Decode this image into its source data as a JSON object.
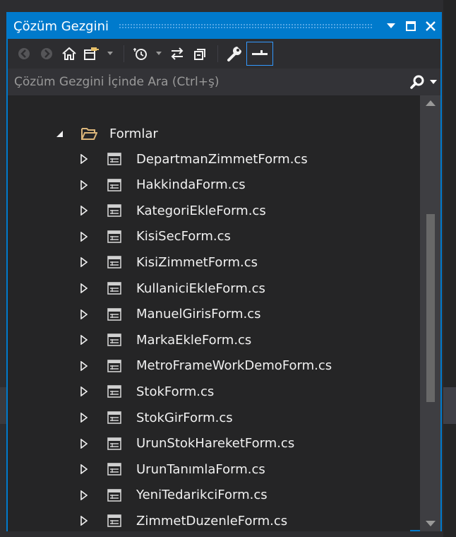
{
  "panel": {
    "title": "Çözüm Gezgini",
    "accent": "#007acc"
  },
  "toolbar": {
    "buttons": [
      "back-icon",
      "forward-icon",
      "home-icon",
      "switch-views-icon",
      "dropdown-icon",
      "pending-changes-icon",
      "dropdown-icon",
      "sync-icon",
      "collapse-all-icon",
      "properties-icon",
      "preview-icon"
    ]
  },
  "search": {
    "placeholder": "Çözüm Gezgini İçinde Ara (Ctrl+ş)"
  },
  "tree": {
    "folder": "Formlar",
    "items": [
      "DepartmanZimmetForm.cs",
      "HakkindaForm.cs",
      "KategoriEkleForm.cs",
      "KisiSecForm.cs",
      "KisiZimmetForm.cs",
      "KullaniciEkleForm.cs",
      "ManuelGirisForm.cs",
      "MarkaEkleForm.cs",
      "MetroFrameWorkDemoForm.cs",
      "StokForm.cs",
      "StokGirForm.cs",
      "UrunStokHareketForm.cs",
      "UrunTanımlaForm.cs",
      "YeniTedarikciForm.cs",
      "ZimmetDuzenleForm.cs"
    ]
  }
}
